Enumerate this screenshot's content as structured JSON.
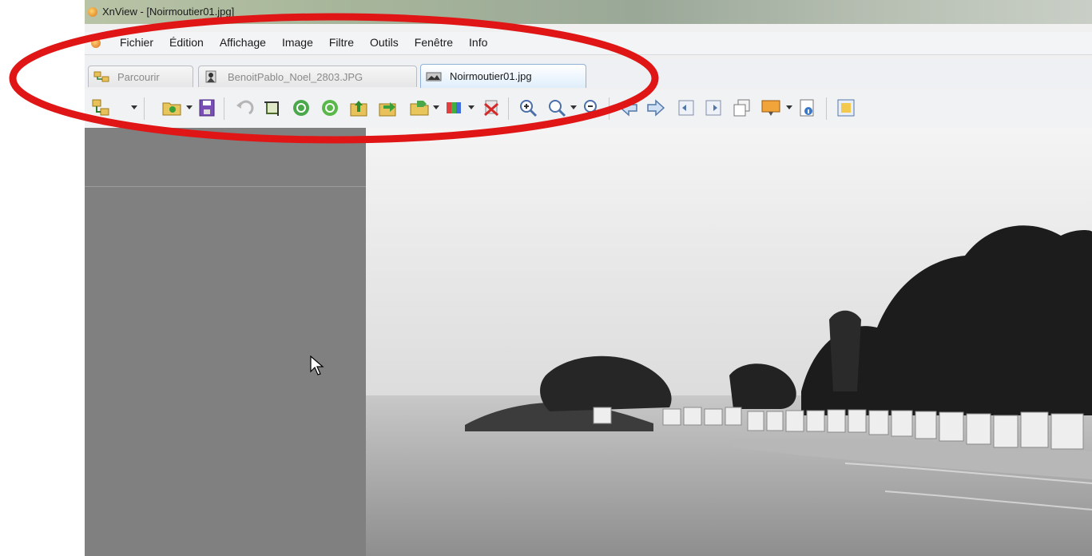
{
  "window": {
    "title": "XnView - [Noirmoutier01.jpg]"
  },
  "menu": {
    "items": [
      "Fichier",
      "Édition",
      "Affichage",
      "Image",
      "Filtre",
      "Outils",
      "Fenêtre",
      "Info"
    ]
  },
  "tabs": [
    {
      "label": "Parcourir",
      "active": false,
      "icon": "folder-tree-icon"
    },
    {
      "label": "BenoitPablo_Noel_2803.JPG",
      "active": false,
      "icon": "image-thumbnail-icon"
    },
    {
      "label": "Noirmoutier01.jpg",
      "active": true,
      "icon": "image-thumbnail-icon"
    }
  ],
  "toolbar": {
    "icons": [
      "browser-icon",
      "open-folder-icon",
      "save-icon",
      "undo-icon",
      "crop-icon",
      "rotate-left-icon",
      "rotate-right-icon",
      "export-icon",
      "convert-icon",
      "move-icon",
      "color-icon",
      "delete-icon",
      "zoom-in-icon",
      "zoom-actual-icon",
      "zoom-out-icon",
      "previous-icon",
      "next-icon",
      "first-page-icon",
      "last-page-icon",
      "copy-icon",
      "slideshow-icon",
      "info-icon"
    ]
  },
  "colors": {
    "annotation": "#e01616",
    "side_panel": "#808080"
  }
}
